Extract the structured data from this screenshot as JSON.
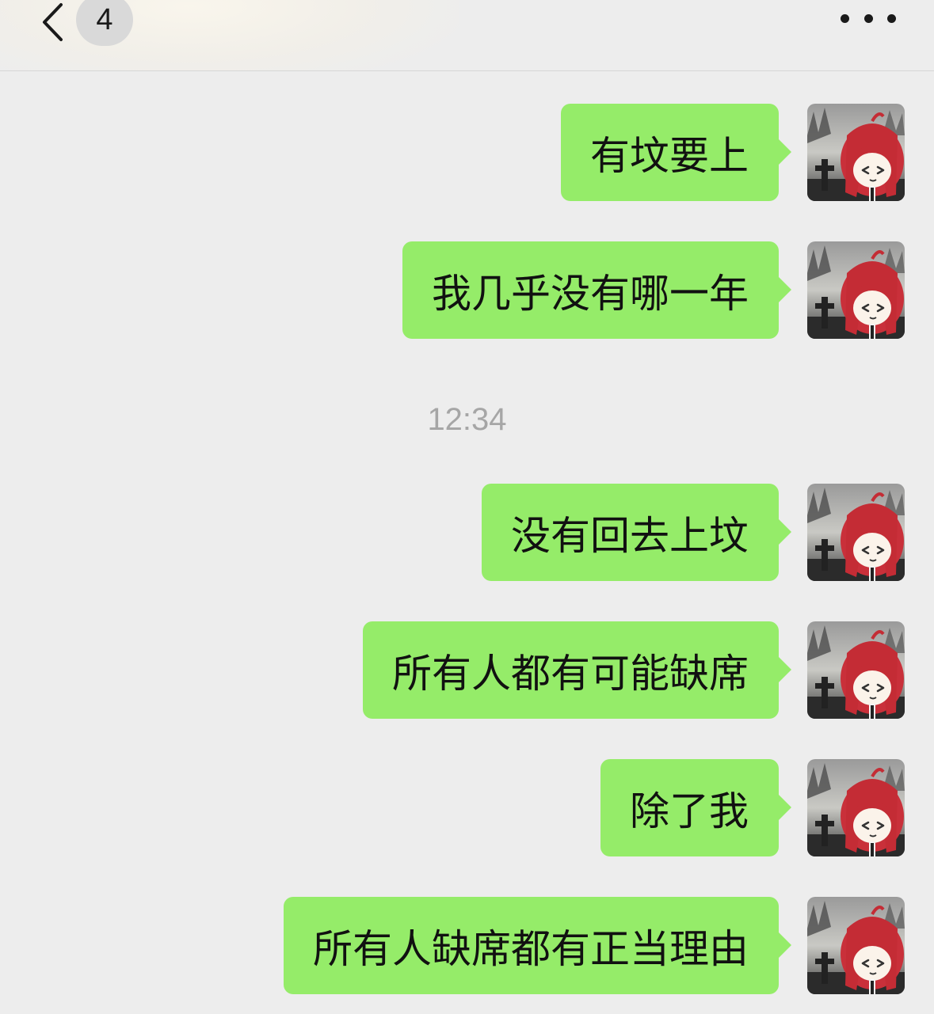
{
  "header": {
    "back_icon": "chevron-left-icon",
    "unread_count": "4",
    "more_icon": "more-dots-icon"
  },
  "colors": {
    "background": "#ededed",
    "bubble_self": "#95ec69",
    "timestamp": "#a6a6a6"
  },
  "messages": [
    {
      "sender": "self",
      "text": "有坟要上"
    },
    {
      "sender": "self",
      "text": "我几乎没有哪一年"
    },
    {
      "sender": "self",
      "text": "没有回去上坟"
    },
    {
      "sender": "self",
      "text": "所有人都有可能缺席"
    },
    {
      "sender": "self",
      "text": "除了我"
    },
    {
      "sender": "self",
      "text": "所有人缺席都有正当理由"
    }
  ],
  "timestamp": "12:34"
}
